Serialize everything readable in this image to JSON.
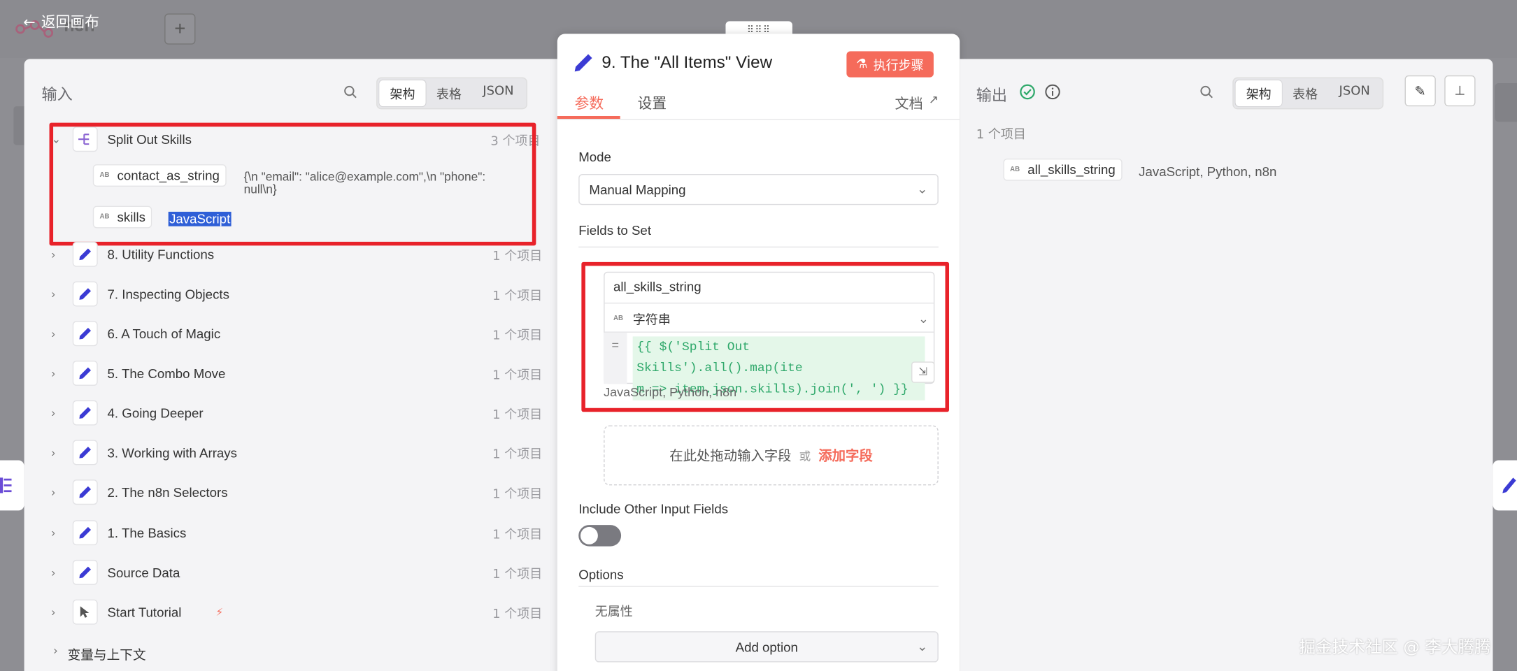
{
  "topbar": {
    "back_label": "返回画布",
    "app_name": "n8n"
  },
  "input_panel": {
    "title": "输入",
    "view_tabs": [
      "架构",
      "表格",
      "JSON"
    ],
    "active_tab": "架构",
    "expanded_node": {
      "name": "Split Out Skills",
      "count": "3 个项目",
      "fields": [
        {
          "name": "contact_as_string",
          "value_line1": "{\\n \"email\": \"alice@example.com\",\\n \"phone\":",
          "value_line2": "null\\n}"
        },
        {
          "name": "skills",
          "value": "JavaScript"
        }
      ]
    },
    "nodes": [
      {
        "label": "8. Utility Functions",
        "count": "1 个项目",
        "icon": "pencil-icon"
      },
      {
        "label": "7. Inspecting Objects",
        "count": "1 个项目",
        "icon": "pencil-icon"
      },
      {
        "label": "6. A Touch of Magic",
        "count": "1 个项目",
        "icon": "pencil-icon"
      },
      {
        "label": "5. The Combo Move",
        "count": "1 个项目",
        "icon": "pencil-icon"
      },
      {
        "label": "4. Going Deeper",
        "count": "1 个项目",
        "icon": "pencil-icon"
      },
      {
        "label": "3. Working with Arrays",
        "count": "1 个项目",
        "icon": "pencil-icon"
      },
      {
        "label": "2. The n8n Selectors",
        "count": "1 个项目",
        "icon": "pencil-icon"
      },
      {
        "label": "1. The Basics",
        "count": "1 个项目",
        "icon": "pencil-icon"
      },
      {
        "label": "Source Data",
        "count": "1 个项目",
        "icon": "pencil-icon"
      },
      {
        "label": "Start Tutorial",
        "count": "1 个项目",
        "icon": "cursor-icon"
      }
    ],
    "variables_label": "变量与上下文"
  },
  "node_panel": {
    "title": "9. The \"All Items\" View",
    "execute_label": "执行步骤",
    "tabs": [
      "参数",
      "设置"
    ],
    "active_tab": "参数",
    "docs_label": "文档",
    "mode_label": "Mode",
    "mode_value": "Manual Mapping",
    "fields_to_set_label": "Fields to Set",
    "field": {
      "name": "all_skills_string",
      "type": "字符串",
      "expr_line1": "{{ $('Split Out Skills').all().map(ite",
      "expr_line2": "m => item.json.skills).join(', ') }}",
      "preview": "JavaScript, Python, n8n"
    },
    "drop_hint": "在此处拖动输入字段",
    "or_label": "或",
    "add_field_label": "添加字段",
    "include_other_label": "Include Other Input Fields",
    "include_other_on": false,
    "options_label": "Options",
    "no_props_label": "无属性",
    "add_option_label": "Add option"
  },
  "output_panel": {
    "title": "输出",
    "view_tabs": [
      "架构",
      "表格",
      "JSON"
    ],
    "active_tab": "架构",
    "count": "1 个项目",
    "field_name": "all_skills_string",
    "field_value": "JavaScript, Python, n8n"
  },
  "watermark": "掘金技术社区 @ 李大腾腾",
  "colors": {
    "accent": "#f56b5b",
    "node_icon": "#3b3bd4",
    "highlight": "#e8222a",
    "success": "#2ea86a"
  }
}
